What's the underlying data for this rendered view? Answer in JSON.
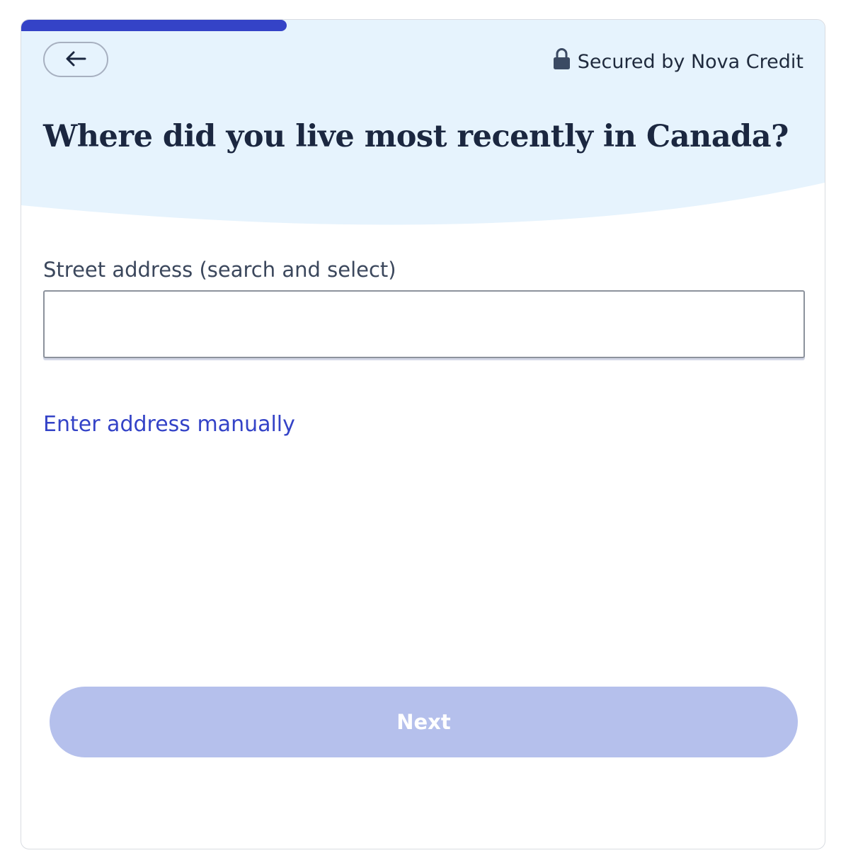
{
  "progress": {
    "value": 0.33
  },
  "header": {
    "back_icon": "arrow-left-icon",
    "secured_icon": "lock-icon",
    "secured_text": "Secured by Nova Credit",
    "title": "Where did you live most recently in Canada?"
  },
  "form": {
    "street_label": "Street address (search and select)",
    "street_value": "",
    "street_placeholder": "",
    "manual_link": "Enter address manually"
  },
  "footer": {
    "next_label": "Next"
  },
  "colors": {
    "accent": "#3443c7",
    "header_bg": "#e6f3fd",
    "title": "#1b2740",
    "disabled_button": "#b5c0ec"
  }
}
